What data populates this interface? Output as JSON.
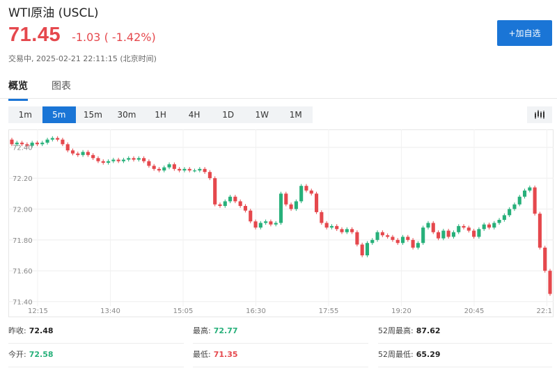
{
  "header": {
    "title": "WTI原油 (USCL)",
    "price": "71.45",
    "change": "-1.03 ( -1.42%)",
    "subline": "交易中, 2025-02-21 22:11:15 (北京时间)",
    "watch_label": "+加自选",
    "accent_color": "#1a75d6",
    "down_color": "#e5484d",
    "up_color": "#27b07a"
  },
  "tabs": [
    {
      "label": "概览",
      "active": true
    },
    {
      "label": "图表",
      "active": false
    }
  ],
  "intervals": [
    "1m",
    "5m",
    "15m",
    "30m",
    "1H",
    "4H",
    "1D",
    "1W",
    "1M"
  ],
  "active_interval": "5m",
  "chart_type_icon": "candlestick-icon",
  "stats": {
    "row1": [
      {
        "label": "昨收:",
        "value": "72.48",
        "color": "neutral"
      },
      {
        "label": "最高:",
        "value": "72.77",
        "color": "up"
      },
      {
        "label": "52周最高:",
        "value": "87.62",
        "color": "neutral"
      }
    ],
    "row2": [
      {
        "label": "今开:",
        "value": "72.58",
        "color": "up"
      },
      {
        "label": "最低:",
        "value": "71.35",
        "color": "down"
      },
      {
        "label": "52周最低:",
        "value": "65.29",
        "color": "neutral"
      }
    ]
  },
  "chart_data": {
    "type": "candlestick",
    "y_ticks": [
      "72.40",
      "72.20",
      "72.00",
      "71.80",
      "71.60",
      "71.40"
    ],
    "x_ticks": [
      "12:15",
      "13:40",
      "15:05",
      "16:30",
      "17:55",
      "19:20",
      "20:45",
      "22:1"
    ],
    "ylim": [
      71.38,
      72.48
    ],
    "grid": true,
    "up_color": "#27b07a",
    "down_color": "#e5484d",
    "candles": [
      [
        72.45,
        72.42
      ],
      [
        72.42,
        72.43
      ],
      [
        72.43,
        72.42
      ],
      [
        72.42,
        72.41
      ],
      [
        72.41,
        72.43
      ],
      [
        72.43,
        72.42
      ],
      [
        72.42,
        72.43
      ],
      [
        72.43,
        72.45
      ],
      [
        72.45,
        72.46
      ],
      [
        72.46,
        72.45
      ],
      [
        72.45,
        72.42
      ],
      [
        72.42,
        72.38
      ],
      [
        72.38,
        72.36
      ],
      [
        72.36,
        72.35
      ],
      [
        72.35,
        72.37
      ],
      [
        72.37,
        72.35
      ],
      [
        72.35,
        72.33
      ],
      [
        72.33,
        72.31
      ],
      [
        72.31,
        72.3
      ],
      [
        72.3,
        72.31
      ],
      [
        72.31,
        72.32
      ],
      [
        72.32,
        72.31
      ],
      [
        72.31,
        72.32
      ],
      [
        72.32,
        72.33
      ],
      [
        72.33,
        72.32
      ],
      [
        72.32,
        72.33
      ],
      [
        72.33,
        72.31
      ],
      [
        72.31,
        72.28
      ],
      [
        72.28,
        72.26
      ],
      [
        72.26,
        72.25
      ],
      [
        72.25,
        72.27
      ],
      [
        72.27,
        72.29
      ],
      [
        72.29,
        72.26
      ],
      [
        72.26,
        72.25
      ],
      [
        72.25,
        72.26
      ],
      [
        72.26,
        72.25
      ],
      [
        72.25,
        72.25
      ],
      [
        72.25,
        72.26
      ],
      [
        72.26,
        72.24
      ],
      [
        72.24,
        72.2
      ],
      [
        72.2,
        72.03
      ],
      [
        72.03,
        72.02
      ],
      [
        72.02,
        72.05
      ],
      [
        72.05,
        72.08
      ],
      [
        72.08,
        72.05
      ],
      [
        72.05,
        72.02
      ],
      [
        72.02,
        71.99
      ],
      [
        71.99,
        71.92
      ],
      [
        71.92,
        71.88
      ],
      [
        71.88,
        71.91
      ],
      [
        71.91,
        71.92
      ],
      [
        71.92,
        71.9
      ],
      [
        71.9,
        71.91
      ],
      [
        71.91,
        72.1
      ],
      [
        72.1,
        72.03
      ],
      [
        72.03,
        72.0
      ],
      [
        72.0,
        72.05
      ],
      [
        72.05,
        72.15
      ],
      [
        72.15,
        72.12
      ],
      [
        72.12,
        72.1
      ],
      [
        72.1,
        71.98
      ],
      [
        71.98,
        71.91
      ],
      [
        71.91,
        71.88
      ],
      [
        71.88,
        71.89
      ],
      [
        71.89,
        71.87
      ],
      [
        71.87,
        71.85
      ],
      [
        71.85,
        71.87
      ],
      [
        71.87,
        71.85
      ],
      [
        71.85,
        71.77
      ],
      [
        71.77,
        71.7
      ],
      [
        71.7,
        71.78
      ],
      [
        71.78,
        71.8
      ],
      [
        71.8,
        71.85
      ],
      [
        71.85,
        71.83
      ],
      [
        71.83,
        71.82
      ],
      [
        71.82,
        71.8
      ],
      [
        71.8,
        71.78
      ],
      [
        71.78,
        71.82
      ],
      [
        71.82,
        71.8
      ],
      [
        71.8,
        71.75
      ],
      [
        71.75,
        71.78
      ],
      [
        71.78,
        71.88
      ],
      [
        71.88,
        71.91
      ],
      [
        71.91,
        71.85
      ],
      [
        71.85,
        71.81
      ],
      [
        71.81,
        71.86
      ],
      [
        71.86,
        71.82
      ],
      [
        71.82,
        71.85
      ],
      [
        71.85,
        71.89
      ],
      [
        71.89,
        71.88
      ],
      [
        71.88,
        71.86
      ],
      [
        71.86,
        71.82
      ],
      [
        71.82,
        71.87
      ],
      [
        71.87,
        71.9
      ],
      [
        71.9,
        71.88
      ],
      [
        71.88,
        71.91
      ],
      [
        71.91,
        71.93
      ],
      [
        71.93,
        71.96
      ],
      [
        71.96,
        72.0
      ],
      [
        72.0,
        72.03
      ],
      [
        72.03,
        72.08
      ],
      [
        72.08,
        72.12
      ],
      [
        72.12,
        72.14
      ],
      [
        72.14,
        71.97
      ],
      [
        71.97,
        71.75
      ],
      [
        71.75,
        71.6
      ],
      [
        71.6,
        71.45
      ]
    ]
  }
}
